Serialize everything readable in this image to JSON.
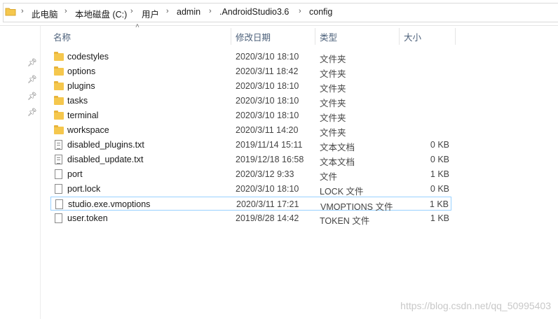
{
  "breadcrumb": {
    "items": [
      "此电脑",
      "本地磁盘 (C:)",
      "用户",
      "admin",
      ".AndroidStudio3.6",
      "config"
    ],
    "separator": "›",
    "folder_icon": "folder-icon"
  },
  "columns": {
    "name": "名称",
    "date": "修改日期",
    "type": "类型",
    "size": "大小"
  },
  "nav": {
    "pins": [
      "pin-icon",
      "pin-icon",
      "pin-icon",
      "pin-icon"
    ]
  },
  "files": [
    {
      "name": "codestyles",
      "date": "2020/3/10 18:10",
      "type": "文件夹",
      "size": "",
      "icon": "folder-icon"
    },
    {
      "name": "options",
      "date": "2020/3/11 18:42",
      "type": "文件夹",
      "size": "",
      "icon": "folder-icon"
    },
    {
      "name": "plugins",
      "date": "2020/3/10 18:10",
      "type": "文件夹",
      "size": "",
      "icon": "folder-icon"
    },
    {
      "name": "tasks",
      "date": "2020/3/10 18:10",
      "type": "文件夹",
      "size": "",
      "icon": "folder-icon"
    },
    {
      "name": "terminal",
      "date": "2020/3/10 18:10",
      "type": "文件夹",
      "size": "",
      "icon": "folder-icon"
    },
    {
      "name": "workspace",
      "date": "2020/3/11 14:20",
      "type": "文件夹",
      "size": "",
      "icon": "folder-icon"
    },
    {
      "name": "disabled_plugins.txt",
      "date": "2019/11/14 15:11",
      "type": "文本文档",
      "size": "0 KB",
      "icon": "text-file-icon"
    },
    {
      "name": "disabled_update.txt",
      "date": "2019/12/18 16:58",
      "type": "文本文档",
      "size": "0 KB",
      "icon": "text-file-icon"
    },
    {
      "name": "port",
      "date": "2020/3/12 9:33",
      "type": "文件",
      "size": "1 KB",
      "icon": "file-icon"
    },
    {
      "name": "port.lock",
      "date": "2020/3/10 18:10",
      "type": "LOCK 文件",
      "size": "0 KB",
      "icon": "file-icon"
    },
    {
      "name": "studio.exe.vmoptions",
      "date": "2020/3/11 17:21",
      "type": "VMOPTIONS 文件",
      "size": "1 KB",
      "icon": "file-icon",
      "selected": true
    },
    {
      "name": "user.token",
      "date": "2019/8/28 14:42",
      "type": "TOKEN 文件",
      "size": "1 KB",
      "icon": "file-icon"
    }
  ],
  "watermark": "https://blog.csdn.net/qq_50995403",
  "colors": {
    "folder": "#f5c74d",
    "selection_border": "#99d1ff",
    "header_text": "#4c607a"
  }
}
